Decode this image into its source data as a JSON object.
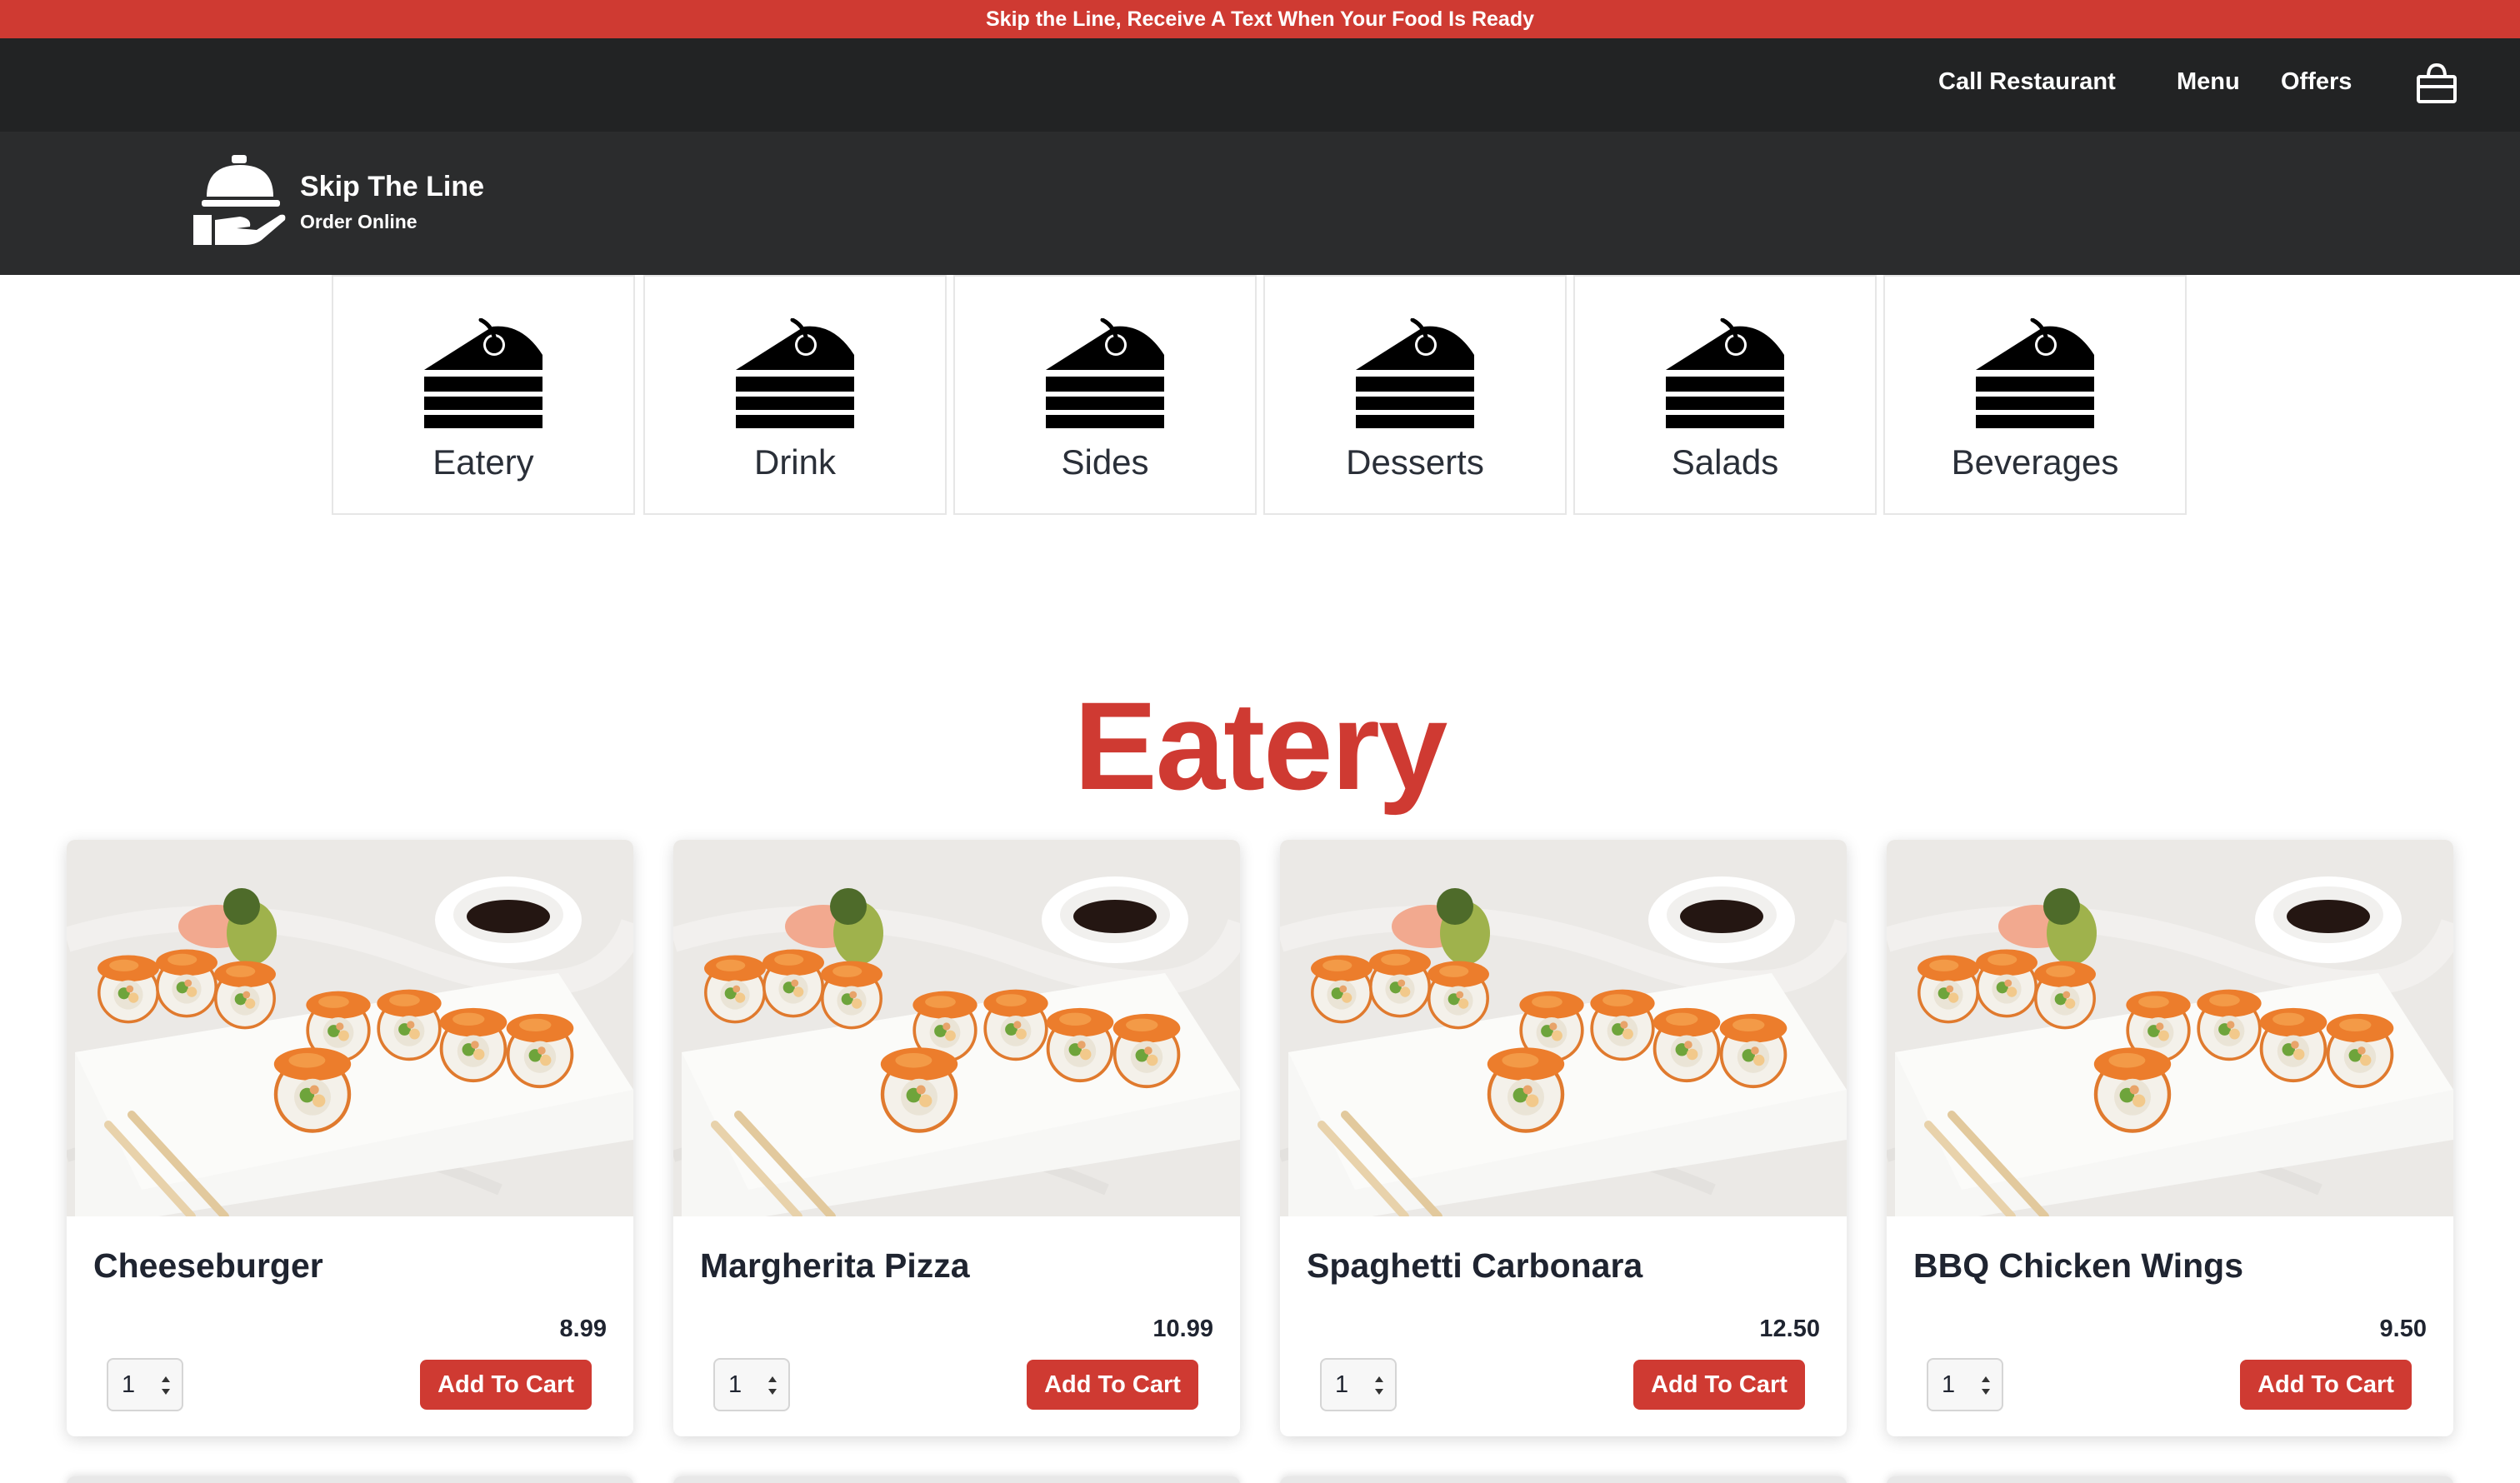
{
  "announcement": "Skip the Line, Receive A Text When Your Food Is Ready",
  "nav": {
    "call": "Call Restaurant",
    "menu": "Menu",
    "offers": "Offers"
  },
  "brand": {
    "title": "Skip The Line",
    "subtitle": "Order Online"
  },
  "categories": [
    {
      "label": "Eatery",
      "icon": "cake-slice-icon"
    },
    {
      "label": "Drink",
      "icon": "cake-slice-icon"
    },
    {
      "label": "Sides",
      "icon": "cake-slice-icon"
    },
    {
      "label": "Desserts",
      "icon": "cake-slice-icon"
    },
    {
      "label": "Salads",
      "icon": "cake-slice-icon"
    },
    {
      "label": "Beverages",
      "icon": "cake-slice-icon"
    }
  ],
  "section_title": "Eatery",
  "products": [
    {
      "name": "Cheeseburger",
      "price": "8.99",
      "qty": "1",
      "button": "Add To Cart"
    },
    {
      "name": "Margherita Pizza",
      "price": "10.99",
      "qty": "1",
      "button": "Add To Cart"
    },
    {
      "name": "Spaghetti Carbonara",
      "price": "12.50",
      "qty": "1",
      "button": "Add To Cart"
    },
    {
      "name": "BBQ Chicken Wings",
      "price": "9.50",
      "qty": "1",
      "button": "Add To Cart"
    }
  ],
  "colors": {
    "accent": "#cf3a32",
    "nav_bg": "#222324",
    "brand_bg": "#2b2c2d"
  }
}
